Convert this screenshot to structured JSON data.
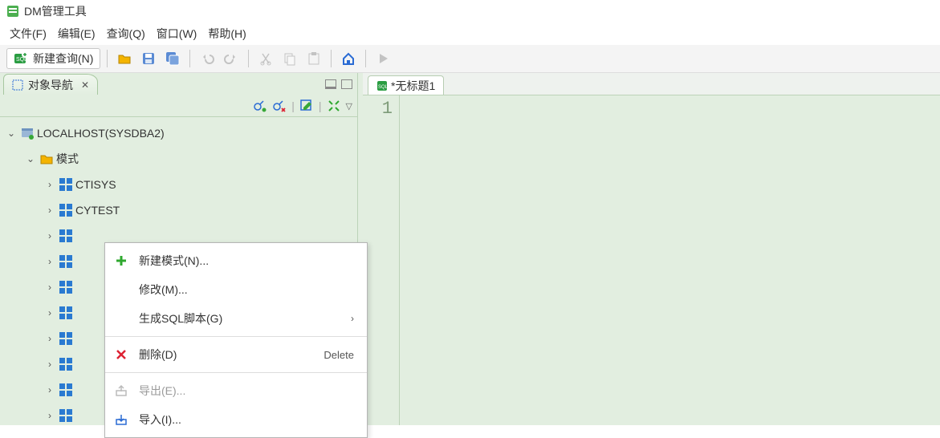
{
  "app": {
    "title": "DM管理工具"
  },
  "menubar": [
    "文件(F)",
    "编辑(E)",
    "查询(Q)",
    "窗口(W)",
    "帮助(H)"
  ],
  "toolbar": {
    "new_query_label": "新建查询(N)"
  },
  "navigator": {
    "tab_title": "对象导航",
    "root": "LOCALHOST(SYSDBA2)",
    "schemas_label": "模式",
    "schemas": [
      "CTISYS",
      "CYTEST"
    ]
  },
  "editor": {
    "tab_title": "*无标题1",
    "gutter_line": "1"
  },
  "context_menu": {
    "items": [
      {
        "icon": "plus",
        "label": "新建模式(N)...",
        "accel": "",
        "submenu": false,
        "disabled": false
      },
      {
        "icon": "",
        "label": "修改(M)...",
        "accel": "",
        "submenu": false,
        "disabled": false
      },
      {
        "icon": "",
        "label": "生成SQL脚本(G)",
        "accel": "",
        "submenu": true,
        "disabled": false
      },
      {
        "sep": true
      },
      {
        "icon": "xred",
        "label": "删除(D)",
        "accel": "Delete",
        "submenu": false,
        "disabled": false
      },
      {
        "sep": true
      },
      {
        "icon": "export",
        "label": "导出(E)...",
        "accel": "",
        "submenu": false,
        "disabled": true
      },
      {
        "icon": "import",
        "label": "导入(I)...",
        "accel": "",
        "submenu": false,
        "disabled": false
      }
    ]
  },
  "colors": {
    "accent_green": "#2a7d1e",
    "panel_bg": "#e2eee0"
  }
}
